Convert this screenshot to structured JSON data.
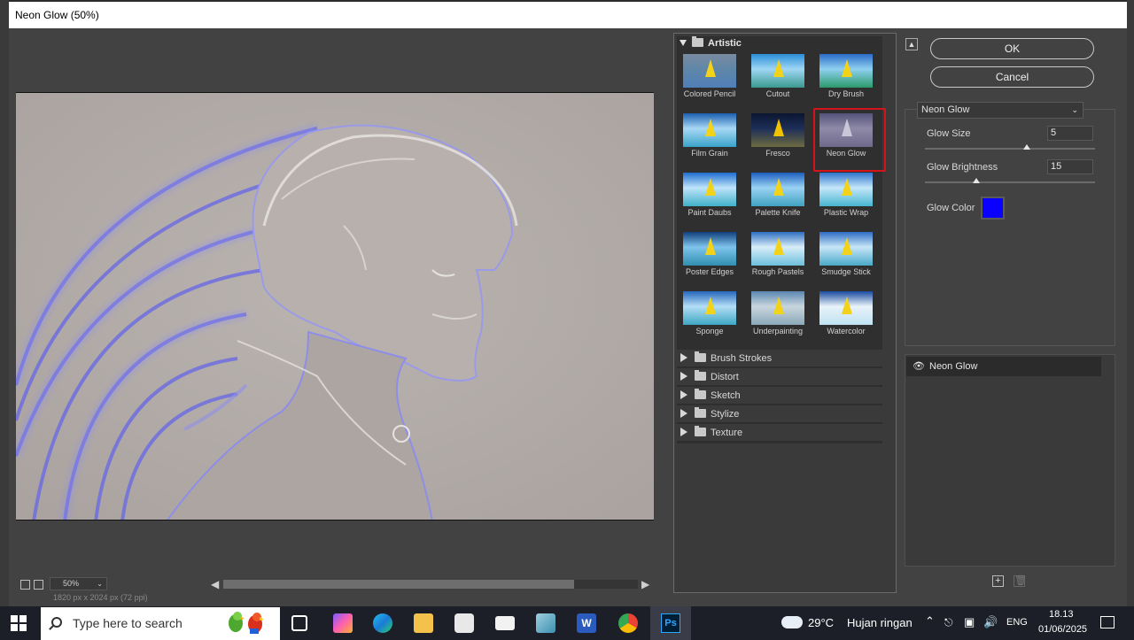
{
  "window": {
    "title": "Neon Glow (50%)"
  },
  "preview": {
    "zoom": "50%",
    "status_text": "1820 px x 2024 px (72 ppi)"
  },
  "gallery": {
    "open_group": "Artistic",
    "filters": [
      {
        "label": "Colored Pencil"
      },
      {
        "label": "Cutout"
      },
      {
        "label": "Dry Brush"
      },
      {
        "label": "Film Grain"
      },
      {
        "label": "Fresco"
      },
      {
        "label": "Neon Glow",
        "selected": true
      },
      {
        "label": "Paint Daubs"
      },
      {
        "label": "Palette Knife"
      },
      {
        "label": "Plastic Wrap"
      },
      {
        "label": "Poster Edges"
      },
      {
        "label": "Rough Pastels"
      },
      {
        "label": "Smudge Stick"
      },
      {
        "label": "Sponge"
      },
      {
        "label": "Underpainting"
      },
      {
        "label": "Watercolor"
      }
    ],
    "categories": [
      "Brush Strokes",
      "Distort",
      "Sketch",
      "Stylize",
      "Texture"
    ]
  },
  "actions": {
    "ok": "OK",
    "cancel": "Cancel"
  },
  "settings": {
    "filter_name": "Neon Glow",
    "glow_size_label": "Glow Size",
    "glow_size": "5",
    "glow_size_fraction": 0.6,
    "glow_brightness_label": "Glow Brightness",
    "glow_brightness": "15",
    "glow_brightness_fraction": 0.3,
    "glow_color_label": "Glow Color",
    "glow_color": "#0a00ff"
  },
  "layers": {
    "items": [
      {
        "name": "Neon Glow"
      }
    ]
  },
  "taskbar": {
    "search_placeholder": "Type here to search",
    "weather_temp": "29°C",
    "weather_text": "Hujan ringan",
    "language": "ENG",
    "time": "18.13",
    "date": "01/06/2025"
  }
}
